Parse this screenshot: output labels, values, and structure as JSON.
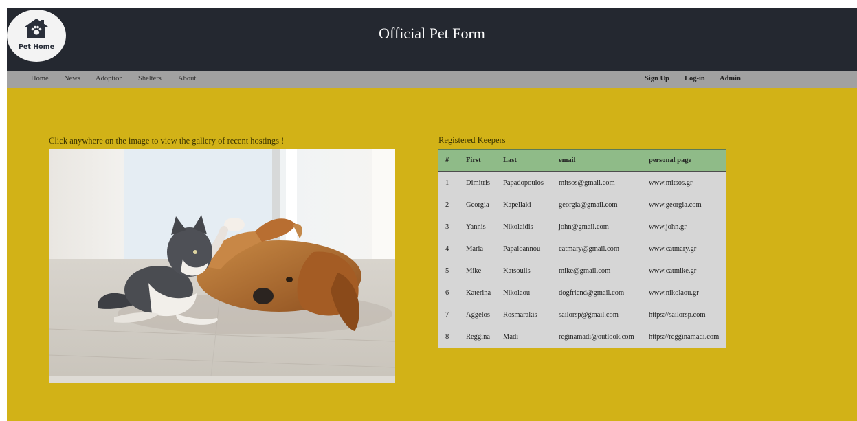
{
  "header": {
    "logo_text": "Pet Home",
    "title": "Official Pet Form",
    "logo_icon": "house-paw-icon"
  },
  "nav": {
    "left": [
      "Home",
      "News",
      "Adoption",
      "Shelters",
      "About"
    ],
    "right": [
      "Sign Up",
      "Log-in",
      "Admin"
    ]
  },
  "gallery": {
    "caption": "Click anywhere on the image to view the gallery of recent hostings !"
  },
  "keepers": {
    "title": "Registered Keepers",
    "columns": [
      "#",
      "First",
      "Last",
      "email",
      "personal page"
    ],
    "rows": [
      [
        "1",
        "Dimitris",
        "Papadopoulos",
        "mitsos@gmail.com",
        "www.mitsos.gr"
      ],
      [
        "2",
        "Georgia",
        "Kapellaki",
        "georgia@gmail.com",
        "www.georgia.com"
      ],
      [
        "3",
        "Yannis",
        "Nikolaidis",
        "john@gmail.com",
        "www.john.gr"
      ],
      [
        "4",
        "Maria",
        "Papaioannou",
        "catmary@gmail.com",
        "www.catmary.gr"
      ],
      [
        "5",
        "Mike",
        "Katsoulis",
        "mike@gmail.com",
        "www.catmike.gr"
      ],
      [
        "6",
        "Katerina",
        "Nikolaou",
        "dogfriend@gmail.com",
        "www.nikolaou.gr"
      ],
      [
        "7",
        "Aggelos",
        "Rosmarakis",
        "sailorsp@gmail.com",
        "https://sailorsp.com"
      ],
      [
        "8",
        "Reggina",
        "Madi",
        "reginamadi@outlook.com",
        "https://regginamadi.com"
      ]
    ]
  },
  "colors": {
    "header_bg": "#242830",
    "nav_bg": "#a1a1a1",
    "main_bg": "#d2b217",
    "table_header_bg": "#8fbb88",
    "table_row_bg": "#d6d6d6"
  }
}
